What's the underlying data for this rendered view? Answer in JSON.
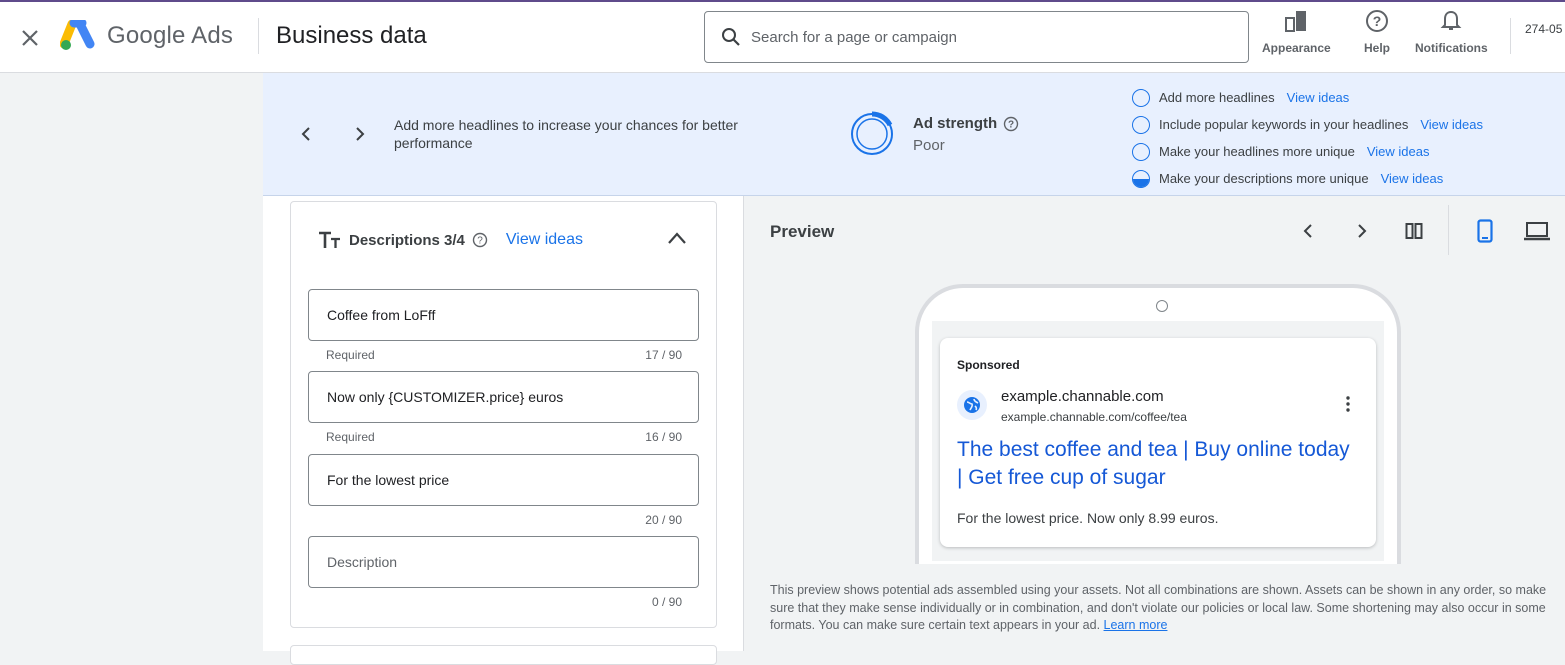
{
  "header": {
    "brand": "Google Ads",
    "page_title": "Business data",
    "search_placeholder": "Search for a page or campaign",
    "actions": [
      {
        "label": "Appearance",
        "icon": "appearance-icon"
      },
      {
        "label": "Help",
        "icon": "help-icon"
      },
      {
        "label": "Notifications",
        "icon": "bell-icon"
      }
    ],
    "account": "274-05"
  },
  "banner": {
    "message": "Add more headlines to increase your chances for better performance",
    "strength_title": "Ad strength",
    "strength_value": "Poor",
    "tips": [
      {
        "text": "Add more headlines",
        "link": "View ideas",
        "state": "empty"
      },
      {
        "text": "Include popular keywords in your headlines",
        "link": "View ideas",
        "state": "empty"
      },
      {
        "text": "Make your headlines more unique",
        "link": "View ideas",
        "state": "empty"
      },
      {
        "text": "Make your descriptions more unique",
        "link": "View ideas",
        "state": "half"
      }
    ]
  },
  "descriptions": {
    "title": "Descriptions 3/4",
    "view_ideas": "View ideas",
    "fields": [
      {
        "value": "Coffee from LoFff",
        "placeholder": "",
        "hint": "Required",
        "count": "17 / 90"
      },
      {
        "value": "Now only {CUSTOMIZER.price} euros",
        "placeholder": "",
        "hint": "Required",
        "count": "16 / 90"
      },
      {
        "value": "For the lowest price",
        "placeholder": "",
        "hint": "",
        "count": "20 / 90"
      },
      {
        "value": "",
        "placeholder": "Description",
        "hint": "",
        "count": "0 / 90"
      }
    ]
  },
  "preview": {
    "title": "Preview",
    "ad": {
      "sponsored": "Sponsored",
      "domain": "example.channable.com",
      "url": "example.channable.com/coffee/tea",
      "headline": "The best coffee and tea | Buy online today | Get free cup of sugar",
      "description": "For the lowest price. Now only 8.99 euros."
    },
    "disclaimer": "This preview shows potential ads assembled using your assets. Not all combinations are shown. Assets can be shown in any order, so make sure that they make sense individually or in combination, and don't violate our policies or local law. Some shortening may also occur in some formats. You can make sure certain text appears in your ad.",
    "learn_more": "Learn more"
  },
  "colors": {
    "accent": "#1a73e8",
    "banner_bg": "#e8f0fe",
    "headline_link": "#1558d6"
  }
}
